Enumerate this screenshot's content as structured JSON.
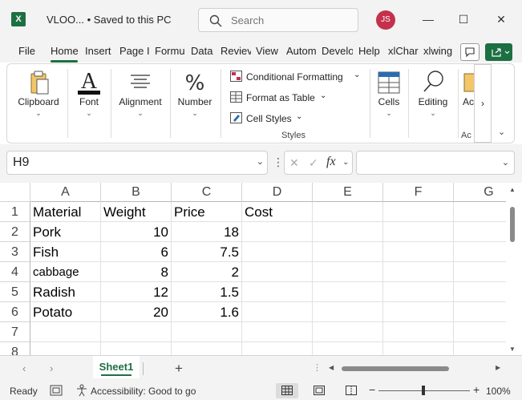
{
  "titlebar": {
    "app_icon": "excel-icon",
    "title": "VLOO...  •  Saved to this PC",
    "search_placeholder": "Search",
    "avatar_initials": "JS",
    "minimize": "—",
    "maximize": "☐",
    "close": "✕"
  },
  "tabs": [
    "File",
    "Home",
    "Insert",
    "Page I",
    "Formu",
    "Data",
    "Reviev",
    "View",
    "Autom",
    "Develo",
    "Help",
    "xlChar",
    "xlwing"
  ],
  "active_tab": "Home",
  "ribbon": {
    "clipboard": "Clipboard",
    "font": "Font",
    "alignment": "Alignment",
    "number": "Number",
    "conditional_formatting": "Conditional Formatting",
    "format_as_table": "Format as Table",
    "cell_styles": "Cell Styles",
    "styles_group": "Styles",
    "cells": "Cells",
    "editing": "Editing",
    "addins": "Ac",
    "addins_group": "Ac",
    "more": "›",
    "chevron": "⌄"
  },
  "formula_bar": {
    "name_box": "H9",
    "formula": "",
    "fx": "fx"
  },
  "grid": {
    "columns": [
      "A",
      "B",
      "C",
      "D",
      "E",
      "F",
      "G"
    ],
    "rows": [
      "1",
      "2",
      "3",
      "4",
      "5",
      "6",
      "7",
      "8"
    ],
    "cells": [
      [
        "Material",
        "Weight",
        "Price",
        "Cost"
      ],
      [
        "Pork",
        "10",
        "18",
        ""
      ],
      [
        "Fish",
        "6",
        "7.5",
        ""
      ],
      [
        "cabbage",
        "8",
        "2",
        ""
      ],
      [
        "Radish",
        "12",
        "1.5",
        ""
      ],
      [
        "Potato",
        "20",
        "1.6",
        ""
      ]
    ]
  },
  "sheets": {
    "tabs": [
      "Sheet1"
    ],
    "active": "Sheet1",
    "add": "+",
    "dots": "⋮"
  },
  "status": {
    "ready": "Ready",
    "accessibility": "Accessibility: Good to go",
    "zoom": "100%",
    "minus": "−",
    "plus": "+"
  },
  "colors": {
    "accent": "#1d6f42",
    "avatar": "#c4314b"
  }
}
